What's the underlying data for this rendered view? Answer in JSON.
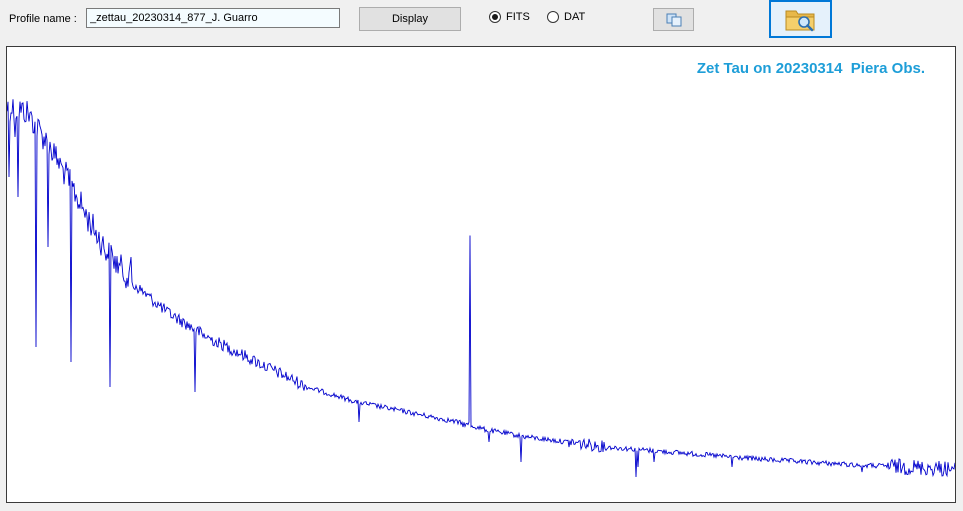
{
  "toolbar": {
    "profile_label": "Profile name :",
    "profile_value": "_zettau_20230314_877_J. Guarro",
    "display_label": "Display",
    "format_options": [
      {
        "label": "FITS",
        "selected": true
      },
      {
        "label": "DAT",
        "selected": false
      }
    ],
    "copy_icon": "copy-icon",
    "open_icon": "folder-search-icon"
  },
  "chart_data": {
    "type": "line",
    "title": "Zet Tau on 20230314  Piera Obs.",
    "series_color": "#0000cc",
    "title_color": "#1e9ed8"
  }
}
